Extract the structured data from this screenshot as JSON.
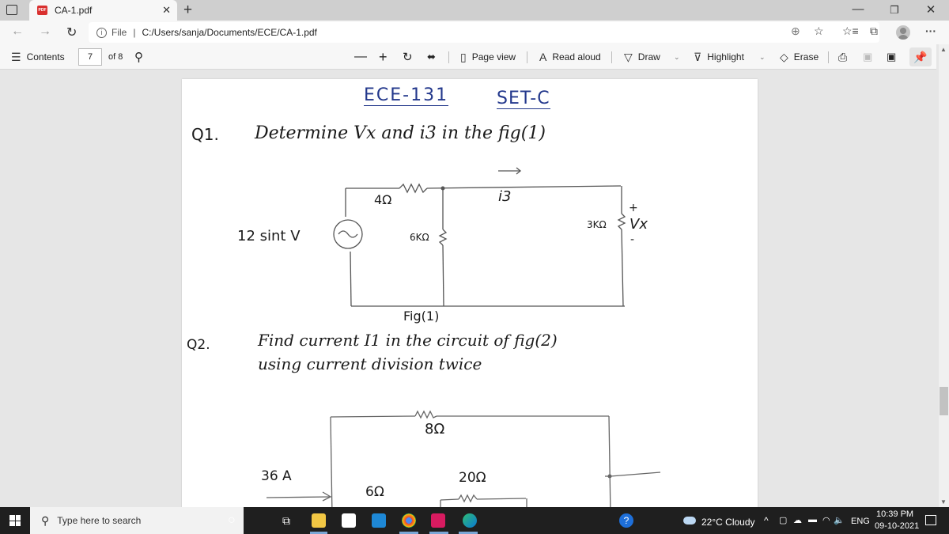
{
  "browser": {
    "tab_title": "CA-1.pdf",
    "tab_icon_label": "PDF",
    "address_prefix": "File",
    "address_url": "C:/Users/sanja/Documents/ECE/CA-1.pdf",
    "window_controls": {
      "minimize": "—",
      "maximize": "❐",
      "close": "✕"
    },
    "icons": [
      "tab-actions-icon",
      "back-icon",
      "forward-icon",
      "refresh-icon",
      "info-icon",
      "zoom-icon",
      "add-favorite-icon",
      "favorites-icon",
      "collections-icon",
      "profile-avatar",
      "more-icon"
    ]
  },
  "pdf_toolbar": {
    "contents_label": "Contents",
    "page_current": "7",
    "page_total": "of 8",
    "zoom_out": "—",
    "zoom_in": "+",
    "page_view_label": "Page view",
    "read_aloud_label": "Read aloud",
    "draw_label": "Draw",
    "highlight_label": "Highlight",
    "erase_label": "Erase"
  },
  "document": {
    "header_course": "ECE-131",
    "header_set": "SET-C",
    "q1_number": "Q1.",
    "q1_text": "Determine  Vx  and  i3  in the  fig(1)",
    "fig1": {
      "r1": "4Ω",
      "current_label": "i3",
      "source": "12 sint V",
      "r2": "6KΩ",
      "r3": "3KΩ",
      "vx": "Vx",
      "plus": "+",
      "minus": "-",
      "caption": "Fig(1)"
    },
    "q2_number": "Q2.",
    "q2_line1": "Find  current  I1  in the  circuit  of fig(2)",
    "q2_line2": "using   current  division  twice",
    "fig2": {
      "r_top": "8Ω",
      "source_current": "36 A",
      "r_left": "6Ω",
      "r_mid": "20Ω"
    }
  },
  "taskbar": {
    "search_placeholder": "Type here to search",
    "weather": "22°C  Cloudy",
    "language": "ENG",
    "time": "10:39 PM",
    "date": "09-10-2021"
  }
}
